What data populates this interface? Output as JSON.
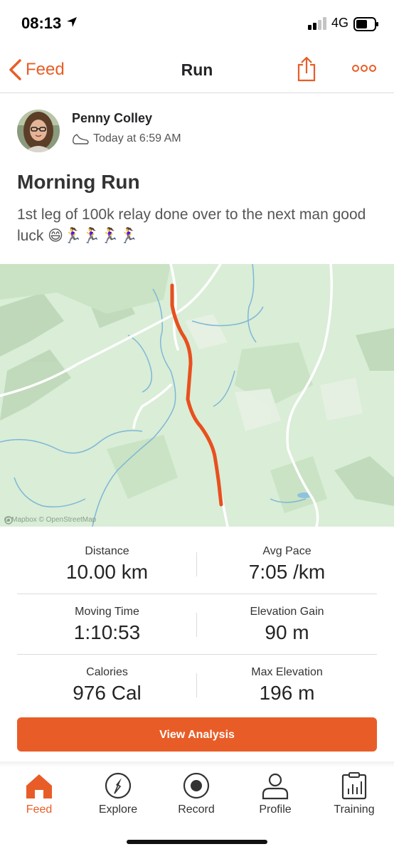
{
  "status_bar": {
    "time": "08:13",
    "network": "4G",
    "location_icon": "location-arrow-icon",
    "signal_icon": "signal-bars-icon",
    "battery_icon": "battery-icon"
  },
  "nav": {
    "back_label": "Feed",
    "title": "Run",
    "share_icon": "share-icon",
    "more_icon": "more-options-icon"
  },
  "activity": {
    "athlete_name": "Penny Colley",
    "timestamp": "Today at 6:59 AM",
    "sport_icon": "shoe-icon",
    "title": "Morning Run",
    "description": "1st leg of 100k relay done over to the next man good luck 😄🏃‍♀️🏃‍♀️🏃‍♀️🏃‍♀️"
  },
  "map": {
    "attribution": "© Mapbox © OpenStreetMap",
    "route_color": "#e8501e"
  },
  "stats": [
    [
      {
        "label": "Distance",
        "value": "10.00 km"
      },
      {
        "label": "Avg Pace",
        "value": "7:05 /km"
      }
    ],
    [
      {
        "label": "Moving Time",
        "value": "1:10:53"
      },
      {
        "label": "Elevation Gain",
        "value": "90 m"
      }
    ],
    [
      {
        "label": "Calories",
        "value": "976 Cal"
      },
      {
        "label": "Max Elevation",
        "value": "196 m"
      }
    ]
  ],
  "analysis_button": "View Analysis",
  "tabs": [
    {
      "label": "Feed",
      "icon": "home-icon",
      "active": true
    },
    {
      "label": "Explore",
      "icon": "compass-icon",
      "active": false
    },
    {
      "label": "Record",
      "icon": "record-icon",
      "active": false
    },
    {
      "label": "Profile",
      "icon": "profile-icon",
      "active": false
    },
    {
      "label": "Training",
      "icon": "training-icon",
      "active": false
    }
  ],
  "colors": {
    "accent": "#e85d27",
    "text": "#242428",
    "map_land": "#d9edd7"
  }
}
